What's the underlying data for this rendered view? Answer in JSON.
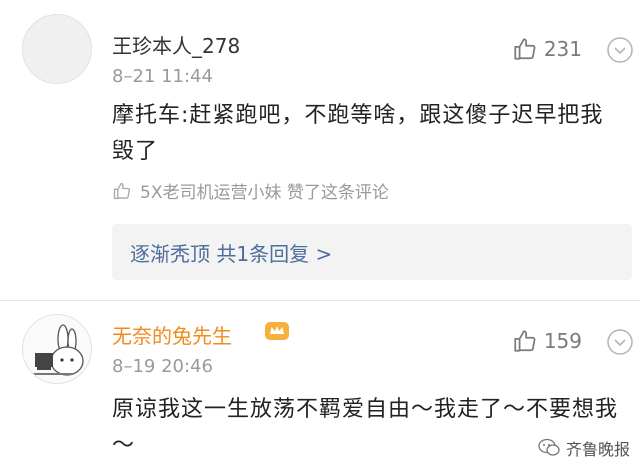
{
  "comments": [
    {
      "username": "王珍本人_278",
      "timestamp": "8–21 11:44",
      "likes": "231",
      "content": "摩托车:赶紧跑吧，不跑等啥，跟这傻子迟早把我毁了",
      "liked_by": "5X老司机运营小妹 赞了这条评论",
      "reply_summary": "逐渐秃顶  共1条回复 >"
    },
    {
      "username": "无奈的兔先生",
      "timestamp": "8–19 20:46",
      "likes": "159",
      "content": "原谅我这一生放荡不羁爱自由～我走了～不要想我～"
    }
  ],
  "watermark": "齐鲁晚报",
  "icons": {
    "like": "thumbs-up-icon",
    "more": "chevron-down-circle-icon",
    "crown": "crown-badge-icon",
    "watermark": "wechat-icon"
  },
  "colors": {
    "vip_username": "#f08b1e",
    "reply_link": "#4d6e9a",
    "reply_bg": "#f3f3f3"
  }
}
